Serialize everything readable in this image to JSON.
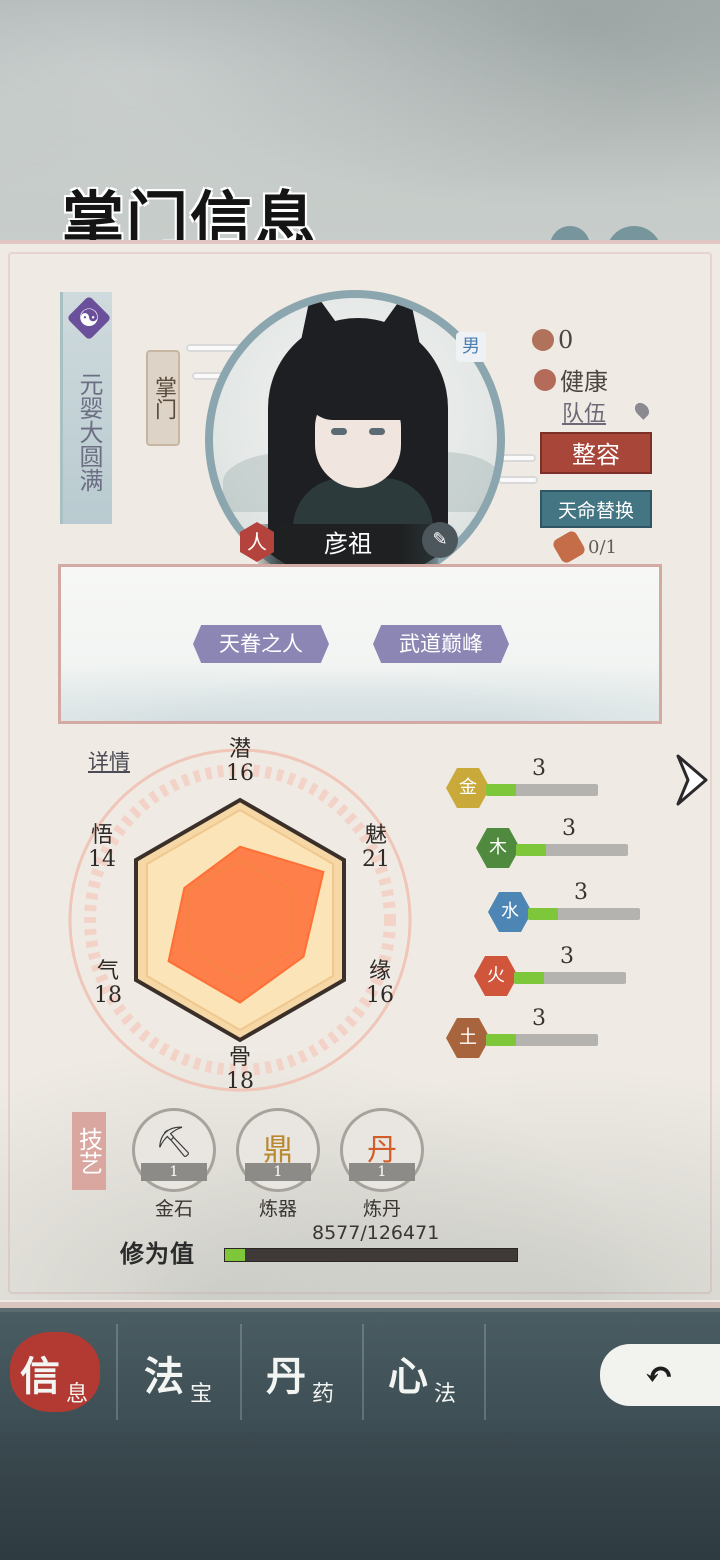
{
  "title": "掌门信息",
  "realm": "元婴大圆满",
  "role": "掌门",
  "gender": "男",
  "name": "彦祖",
  "race_badge": "人",
  "status": {
    "points": "0",
    "health": "健康"
  },
  "team_link": "队伍",
  "buttons": {
    "appearance": "整容",
    "fate_replace": "天命替换"
  },
  "fate_count": "0/1",
  "traits": [
    "天眷之人",
    "武道巅峰"
  ],
  "detail_link": "详情",
  "stats": {
    "qian": {
      "label": "潜",
      "value": "16"
    },
    "mei": {
      "label": "魅",
      "value": "21"
    },
    "yuan": {
      "label": "缘",
      "value": "16"
    },
    "gu": {
      "label": "骨",
      "value": "18"
    },
    "qi": {
      "label": "气",
      "value": "18"
    },
    "wu": {
      "label": "悟",
      "value": "14"
    }
  },
  "elements": [
    {
      "glyph": "金",
      "value": "3",
      "color": "#c9a93a",
      "fill": 0.27
    },
    {
      "glyph": "木",
      "value": "3",
      "color": "#4f8a3f",
      "fill": 0.27
    },
    {
      "glyph": "水",
      "value": "3",
      "color": "#4d86b5",
      "fill": 0.27
    },
    {
      "glyph": "火",
      "value": "3",
      "color": "#d0553a",
      "fill": 0.27
    },
    {
      "glyph": "土",
      "value": "3",
      "color": "#a8643c",
      "fill": 0.27
    }
  ],
  "skills_tag": "技艺",
  "skills": [
    {
      "name": "金石",
      "level": "1",
      "glyph": "⛏"
    },
    {
      "name": "炼器",
      "level": "1",
      "glyph": "鼎"
    },
    {
      "name": "炼丹",
      "level": "1",
      "glyph": "丹"
    }
  ],
  "xp": {
    "label": "修为值",
    "text": "8577/126471",
    "fill": 0.068
  },
  "tabs": [
    {
      "main": "信",
      "sub": "息"
    },
    {
      "main": "法",
      "sub": "宝"
    },
    {
      "main": "丹",
      "sub": "药"
    },
    {
      "main": "心",
      "sub": "法"
    }
  ],
  "colors": {
    "accent_red": "#a9463a",
    "accent_teal": "#437582",
    "trait_purple": "#8c86b5",
    "bar_green": "#7ec63a"
  }
}
